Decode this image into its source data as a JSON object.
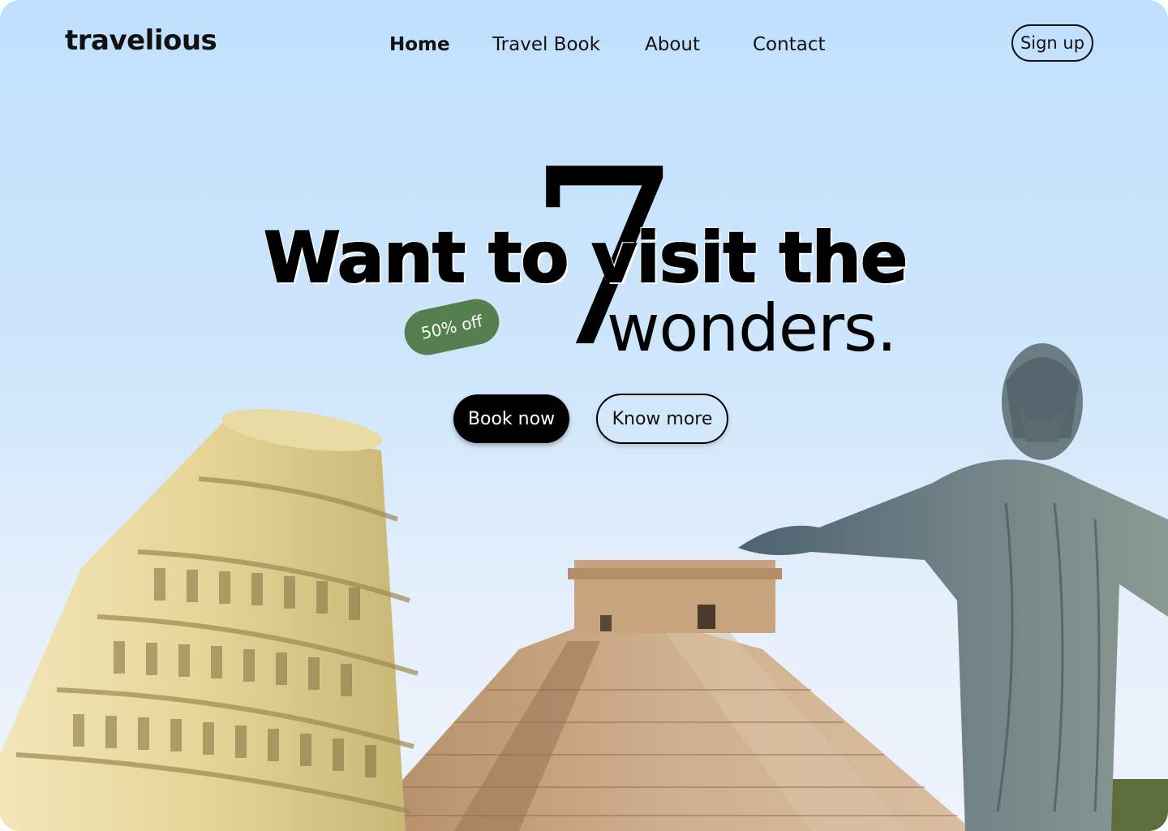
{
  "header": {
    "logo": "travelious",
    "nav": [
      {
        "label": "Home",
        "active": true
      },
      {
        "label": "Travel Book",
        "active": false
      },
      {
        "label": "About",
        "active": false
      },
      {
        "label": "Contact",
        "active": false
      }
    ],
    "signup_label": "Sign up"
  },
  "hero": {
    "line1": "Want to visit the",
    "line2": "wonders.",
    "number": "7",
    "badge": "50% off",
    "badge_color": "#567f4f",
    "primary_cta": "Book now",
    "secondary_cta": "Know more"
  },
  "images": [
    {
      "name": "leaning-tower-of-pisa",
      "tint": "#e8d9a0"
    },
    {
      "name": "chichen-itza-pyramid",
      "tint": "#c9a47c"
    },
    {
      "name": "christ-the-redeemer",
      "tint": "#5e6f7a"
    }
  ],
  "colors": {
    "sky_top": "#bfe0fd",
    "sky_bottom": "#eef3fb",
    "text": "#000000",
    "button_bg": "#000000"
  }
}
